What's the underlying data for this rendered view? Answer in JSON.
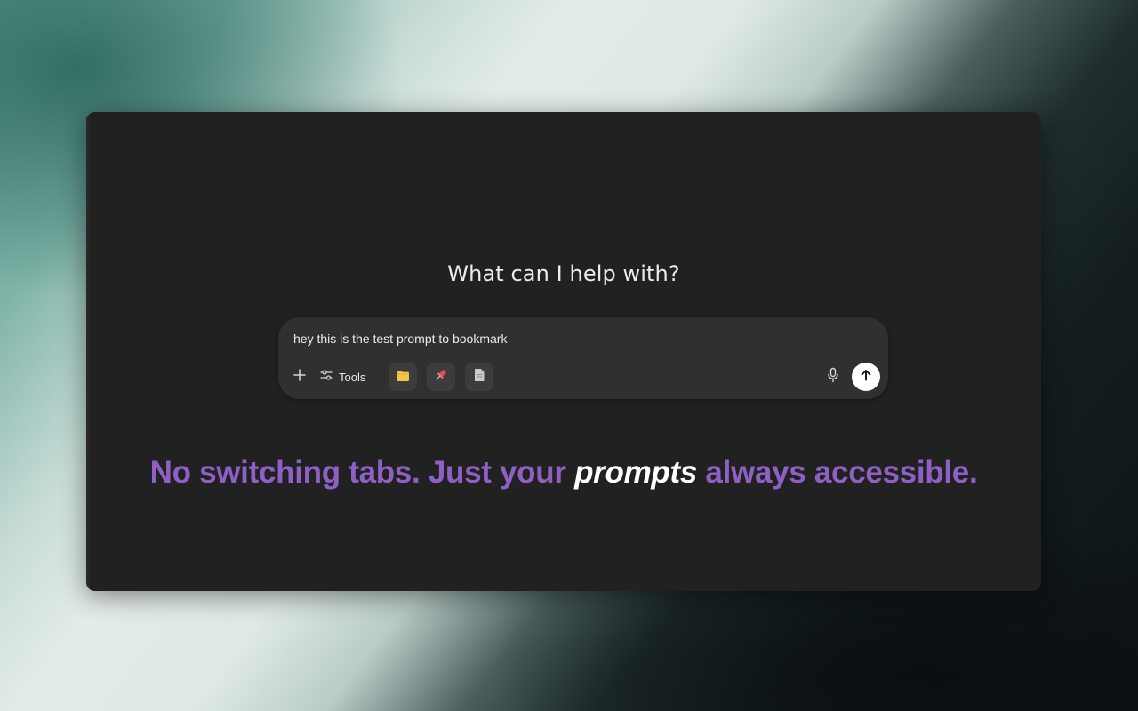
{
  "main": {
    "heading": "What can I help with?"
  },
  "composer": {
    "prompt_text": "hey this is the test prompt to bookmark",
    "tools_label": "Tools",
    "icons": {
      "plus": "plus-icon",
      "tools": "sliders-icon",
      "folder": "folder-icon",
      "pin": "pin-icon",
      "document": "document-icon",
      "mic": "microphone-icon",
      "send": "arrow-up-icon"
    }
  },
  "tagline": {
    "part1": "No switching tabs. Just your ",
    "emphasis": "prompts",
    "part2": " always accessible."
  },
  "colors": {
    "accent": "#8e5fc4",
    "folder": "#f4c14d",
    "pin": "#e8475f",
    "window_bg": "#212121",
    "composer_bg": "#303030"
  }
}
